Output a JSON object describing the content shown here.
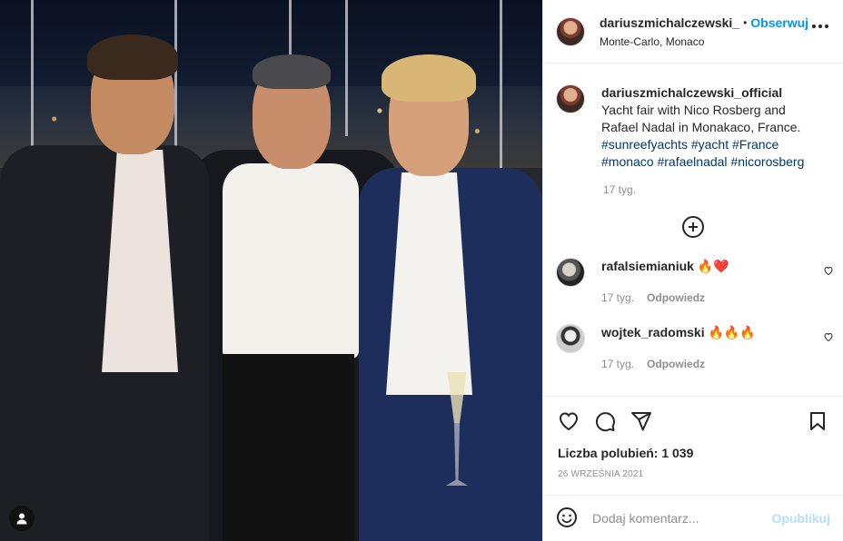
{
  "post": {
    "photo_description_icon": "user-tag-icon"
  },
  "header": {
    "username": "dariuszmichalczewski_",
    "separator": "•",
    "follow_label": "Obserwuj",
    "location": "Monte-Carlo, Monaco"
  },
  "caption": {
    "username": "dariuszmichalczewski_official",
    "text": "Yacht fair with Nico Rosberg and Rafael Nadal in Monakaco, France.",
    "hashtags": [
      "#sunreefyachts",
      "#yacht",
      "#France",
      "#monaco",
      "#rafaelnadal",
      "#nicorosberg"
    ],
    "time": "17 tyg."
  },
  "comments": [
    {
      "username": "rafalsiemianiuk",
      "text": "🔥❤️",
      "time": "17 tyg.",
      "reply_label": "Odpowiedz"
    },
    {
      "username": "wojtek_radomski",
      "text": "🔥🔥🔥",
      "time": "17 tyg.",
      "reply_label": "Odpowiedz"
    }
  ],
  "engagement": {
    "likes": "Liczba polubień: 1 039",
    "date": "26 WRZEŚNIA 2021"
  },
  "composer": {
    "placeholder": "Dodaj komentarz...",
    "post_label": "Opublikuj"
  },
  "colors": {
    "accent": "#0095f6",
    "muted": "#8e8e8e",
    "hashtag": "#00376b",
    "post_disabled": "#b2dffc"
  }
}
